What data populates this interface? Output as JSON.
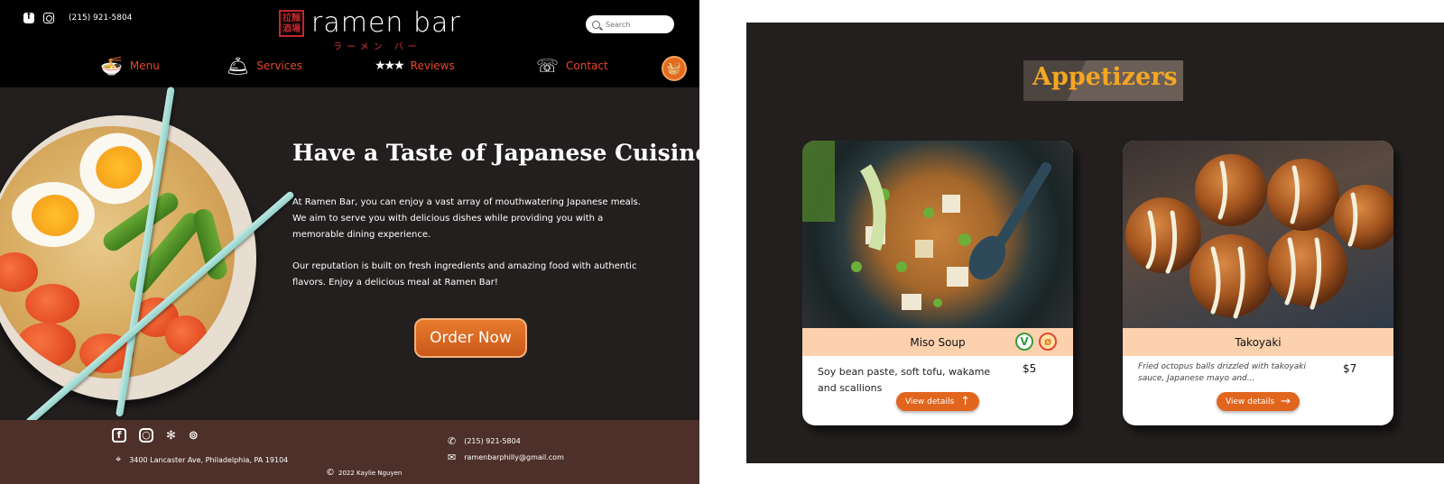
{
  "site": {
    "phone": "(215) 921-5804",
    "logo_name": "ramen bar",
    "logo_subtitle": "ラーメン バー",
    "logo_stamp": "拉麵酒場",
    "search_placeholder": "Search"
  },
  "nav": {
    "items": [
      {
        "label": "Menu",
        "icon": "ramen-bowl-icon"
      },
      {
        "label": "Services",
        "icon": "cloche-icon"
      },
      {
        "label": "Reviews",
        "icon": "stars-icon"
      },
      {
        "label": "Contact",
        "icon": "phone-icon"
      }
    ],
    "basket_icon": "basket-icon"
  },
  "hero": {
    "title": "Have a Taste of Japanese Cuisine",
    "paragraph1": "At Ramen Bar, you can enjoy a vast array of mouthwatering Japanese meals. We aim to serve you with delicious dishes while providing you with a memorable dining experience.",
    "paragraph2": "Our reputation is built on fresh ingredients and amazing food with authentic flavors. Enjoy a delicious meal at Ramen Bar!",
    "order_label": "Order Now"
  },
  "footer": {
    "address": "3400 Lancaster Ave, Philadelphia, PA 19104",
    "phone": "(215) 921-5804",
    "email": "ramenbarphilly@gmail.com",
    "copyright": "2022 Kaylie Nguyen"
  },
  "appetizers": {
    "title": "Appetizers",
    "cards": [
      {
        "name": "Miso Soup",
        "description": "Soy bean paste, soft tofu, wakame and scallions",
        "price": "$5",
        "button_label": "View details",
        "badges": [
          "vegan-icon",
          "gluten-free-icon"
        ]
      },
      {
        "name": "Takoyaki",
        "description": "Fried octopus balls drizzled with takoyaki sauce, Japanese mayo and...",
        "price": "$7",
        "button_label": "View details"
      }
    ]
  },
  "colors": {
    "accent_orange": "#e2651e",
    "nav_red": "#e8462b",
    "heading_gold": "#f5a623",
    "footer_brown": "#4e302a",
    "dark_bg": "#221f1e"
  }
}
